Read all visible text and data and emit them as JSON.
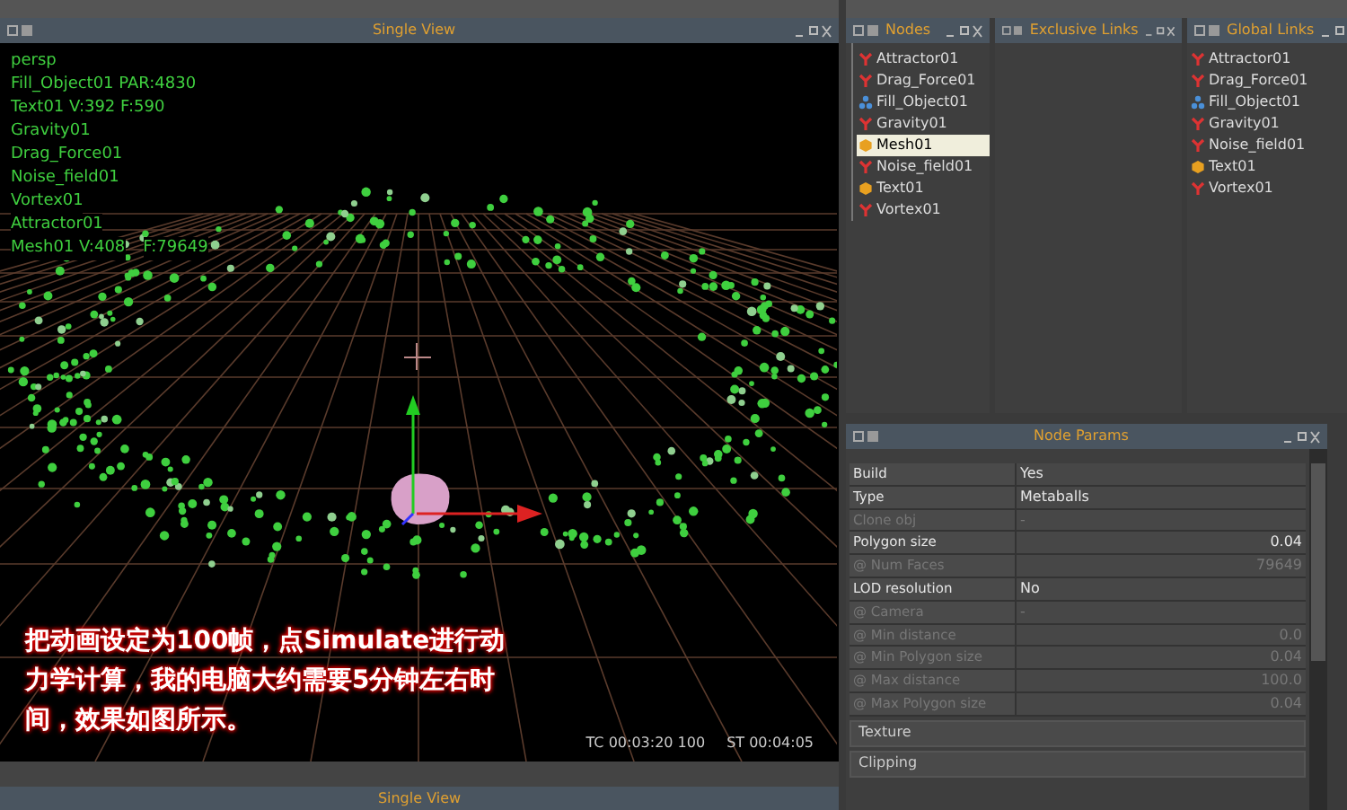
{
  "viewport": {
    "title": "Single View",
    "overlay_lines": [
      "persp",
      "Fill_Object01 PAR:4830",
      "Text01 V:392 F:590",
      "Gravity01",
      "Drag_Force01",
      "Noise_field01",
      "Vortex01",
      "Attractor01"
    ],
    "mesh_line": [
      "Mesh01 V:408",
      "F:79649"
    ],
    "caption": "把动画设定为100帧，点Simulate进行动力学计算，我的电脑大约需要5分钟左右时间，效果如图所示。",
    "timecode": "TC 00:03:20 100",
    "sim_time": "ST 00:04:05"
  },
  "bottom_panel": {
    "title": "Single View"
  },
  "nodes": {
    "title": "Nodes",
    "items": [
      {
        "label": "Attractor01",
        "kind": "force",
        "selected": false
      },
      {
        "label": "Drag_Force01",
        "kind": "force",
        "selected": false
      },
      {
        "label": "Fill_Object01",
        "kind": "fill",
        "selected": false
      },
      {
        "label": "Gravity01",
        "kind": "force",
        "selected": false
      },
      {
        "label": "Mesh01",
        "kind": "object",
        "selected": true
      },
      {
        "label": "Noise_field01",
        "kind": "force",
        "selected": false
      },
      {
        "label": "Text01",
        "kind": "object",
        "selected": false
      },
      {
        "label": "Vortex01",
        "kind": "force",
        "selected": false
      }
    ]
  },
  "exclusive_links": {
    "title": "Exclusive Links"
  },
  "global_links": {
    "title": "Global Links",
    "items": [
      {
        "label": "Attractor01",
        "kind": "force"
      },
      {
        "label": "Drag_Force01",
        "kind": "force"
      },
      {
        "label": "Fill_Object01",
        "kind": "fill"
      },
      {
        "label": "Gravity01",
        "kind": "force"
      },
      {
        "label": "Noise_field01",
        "kind": "force"
      },
      {
        "label": "Text01",
        "kind": "object"
      },
      {
        "label": "Vortex01",
        "kind": "force"
      }
    ]
  },
  "node_params": {
    "title": "Node Params",
    "rows": [
      {
        "label": "Build",
        "value": "Yes",
        "kind": "choice",
        "disabled": false
      },
      {
        "label": "Type",
        "value": "Metaballs",
        "kind": "choice",
        "disabled": false
      },
      {
        "label": "Clone obj",
        "value": "-",
        "kind": "choice",
        "disabled": true
      },
      {
        "label": "Polygon size",
        "value": "0.04",
        "kind": "number",
        "disabled": false
      },
      {
        "label": "@ Num Faces",
        "value": "79649",
        "kind": "number",
        "disabled": true
      },
      {
        "label": "LOD resolution",
        "value": "No",
        "kind": "choice",
        "disabled": false
      },
      {
        "label": "@ Camera",
        "value": "-",
        "kind": "choice",
        "disabled": true
      },
      {
        "label": "@ Min distance",
        "value": "0.0",
        "kind": "number",
        "disabled": true
      },
      {
        "label": "@ Min Polygon size",
        "value": "0.04",
        "kind": "number",
        "disabled": true
      },
      {
        "label": "@ Max distance",
        "value": "100.0",
        "kind": "number",
        "disabled": true
      },
      {
        "label": "@ Max Polygon size",
        "value": "0.04",
        "kind": "number",
        "disabled": true
      }
    ],
    "sections": [
      "Texture",
      "Clipping"
    ]
  }
}
